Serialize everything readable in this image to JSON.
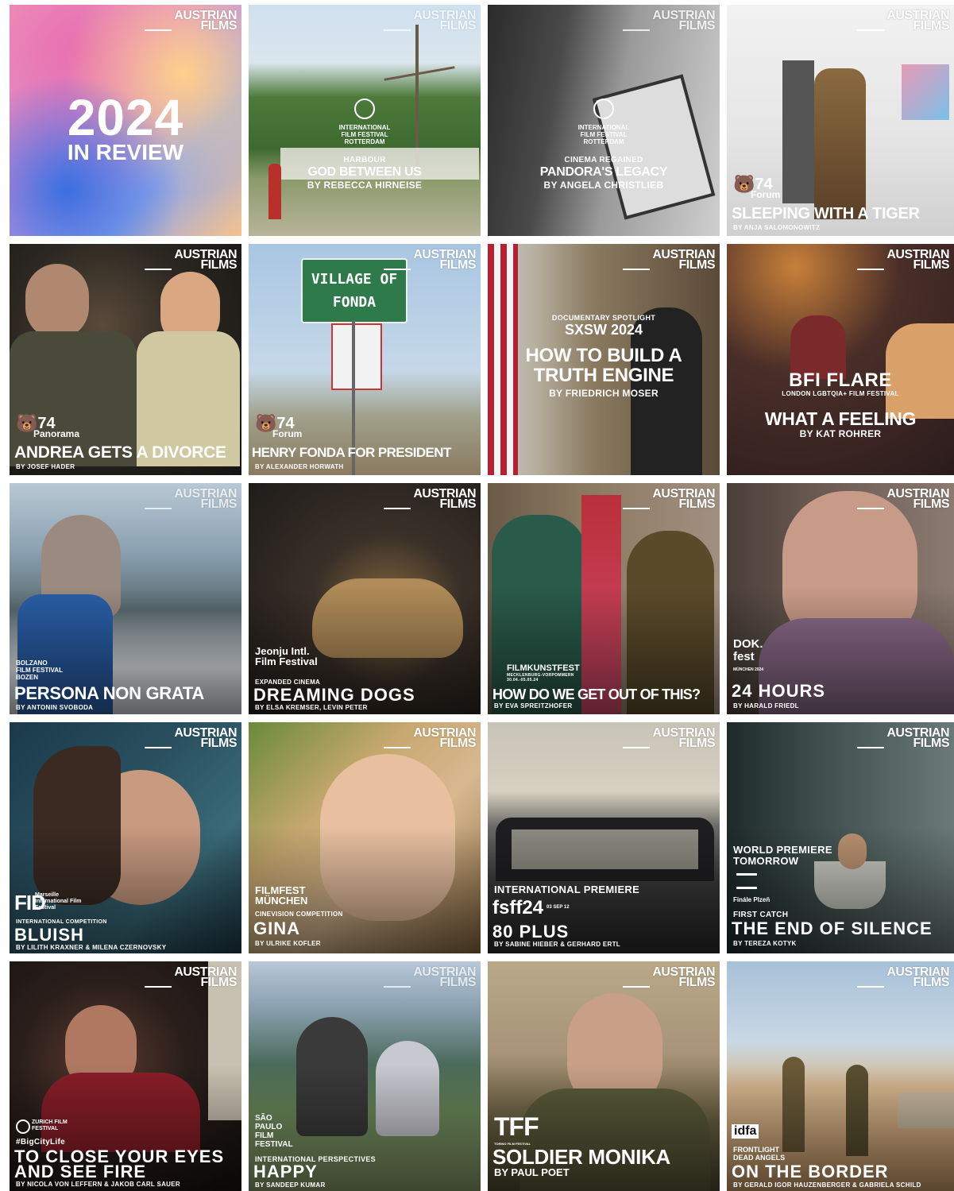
{
  "brand": {
    "line1": "AUSTRIAN",
    "line2": "FILMS"
  },
  "tiles": [
    {
      "id": "review",
      "year": "2024",
      "subtitle": "IN REVIEW"
    },
    {
      "id": "god-between-us",
      "festival": "INTERNATIONAL FILM FESTIVAL ROTTERDAM",
      "section": "HARBOUR",
      "title": "GOD BETWEEN US",
      "credit": "BY REBECCA HIRNEISE"
    },
    {
      "id": "pandoras-legacy",
      "festival": "INTERNATIONAL FILM FESTIVAL ROTTERDAM",
      "section": "CINEMA REGAINED",
      "title": "PANDORA'S LEGACY",
      "credit": "BY ANGELA CHRISTLIEB"
    },
    {
      "id": "sleeping-with-a-tiger",
      "festival_num": "74",
      "festival_section": "Forum",
      "title": "SLEEPING WITH A TIGER",
      "credit": "BY ANJA SALOMONOWITZ"
    },
    {
      "id": "andrea",
      "festival_num": "74",
      "festival_section": "Panorama",
      "title": "ANDREA GETS A DIVORCE",
      "credit": "BY JOSEF HADER"
    },
    {
      "id": "henry-fonda",
      "sign1": "VILLAGE OF",
      "sign2": "FONDA",
      "festival_num": "74",
      "festival_section": "Forum",
      "title": "HENRY FONDA FOR PRESIDENT",
      "credit": "BY ALEXANDER HORWATH"
    },
    {
      "id": "truth-engine",
      "section": "DOCUMENTARY SPOTLIGHT",
      "festival": "SXSW 2024",
      "title": "HOW TO BUILD A TRUTH ENGINE",
      "credit": "BY FRIEDRICH MOSER"
    },
    {
      "id": "what-a-feeling",
      "festival": "BFI FLARE",
      "festival_sub": "LONDON LGBTQIA+ FILM FESTIVAL",
      "title": "WHAT A FEELING",
      "credit": "BY KAT ROHRER"
    },
    {
      "id": "persona-non-grata",
      "festival": "BOLZANO FILM FESTIVAL BOZEN",
      "title": "PERSONA NON GRATA",
      "credit": "BY ANTONIN SVOBODA"
    },
    {
      "id": "dreaming-dogs",
      "festival": "Jeonju Intl. Film Festival",
      "section": "EXPANDED CINEMA",
      "title": "DREAMING DOGS",
      "credit": "BY ELSA KREMSER, LEVIN PETER"
    },
    {
      "id": "get-out",
      "festival": "FILMKUNSTFEST",
      "festival_sub": "MECKLENBURG-VORPOMMERN 30.04.-05.05.24",
      "title": "HOW DO WE GET OUT OF THIS?",
      "credit": "BY EVA SPREITZHOFER"
    },
    {
      "id": "24-hours",
      "festival": "DOK. fest",
      "festival_sub": "MÜNCHEN 2024",
      "title": "24 HOURS",
      "credit": "BY HARALD FRIEDL"
    },
    {
      "id": "bluish",
      "festival": "FID",
      "festival_sub": "Marseille International Film Festival",
      "section": "INTERNATIONAL COMPETITION",
      "title": "BLUISH",
      "credit": "BY LILITH KRAXNER & MILENA CZERNOVSKY"
    },
    {
      "id": "gina",
      "festival": "FILMFEST MÜNCHEN",
      "section": "CINEVISION COMPETITION",
      "title": "GINA",
      "credit": "BY ULRIKE KOFLER"
    },
    {
      "id": "80-plus",
      "section": "INTERNATIONAL PREMIERE",
      "festival": "fsff24",
      "festival_sub": "03 SEP 12",
      "title": "80 PLUS",
      "credit": "BY SABINE HIEBER & GERHARD ERTL"
    },
    {
      "id": "end-of-silence",
      "pre1": "WORLD PREMIERE",
      "pre2": "TOMORROW",
      "festival": "Finále Plzeň",
      "section": "FIRST CATCH",
      "title": "THE END OF SILENCE",
      "credit": "BY TEREZA KOTYK"
    },
    {
      "id": "close-your-eyes",
      "festival": "ZURICH FILM FESTIVAL",
      "section": "#BigCityLife",
      "title1": "TO CLOSE YOUR EYES",
      "title2": "AND SEE FIRE",
      "credit": "BY NICOLA VON LEFFERN & JAKOB CARL SAUER"
    },
    {
      "id": "happy",
      "festival": "SÃO PAULO FILM FESTIVAL",
      "section": "INTERNATIONAL PERSPECTIVES",
      "title": "HAPPY",
      "credit": "BY SANDEEP KUMAR"
    },
    {
      "id": "soldier-monika",
      "festival": "TFF",
      "festival_sub": "TORINO FILM FESTIVAL",
      "title": "SOLDIER MONIKA",
      "credit": "BY PAUL POET"
    },
    {
      "id": "on-the-border",
      "festival": "idfa",
      "section": "FRONTLIGHT DEAD ANGELS",
      "title": "ON THE BORDER",
      "credit": "BY GERALD IGOR HAUZENBERGER & GABRIELA SCHILD"
    }
  ]
}
